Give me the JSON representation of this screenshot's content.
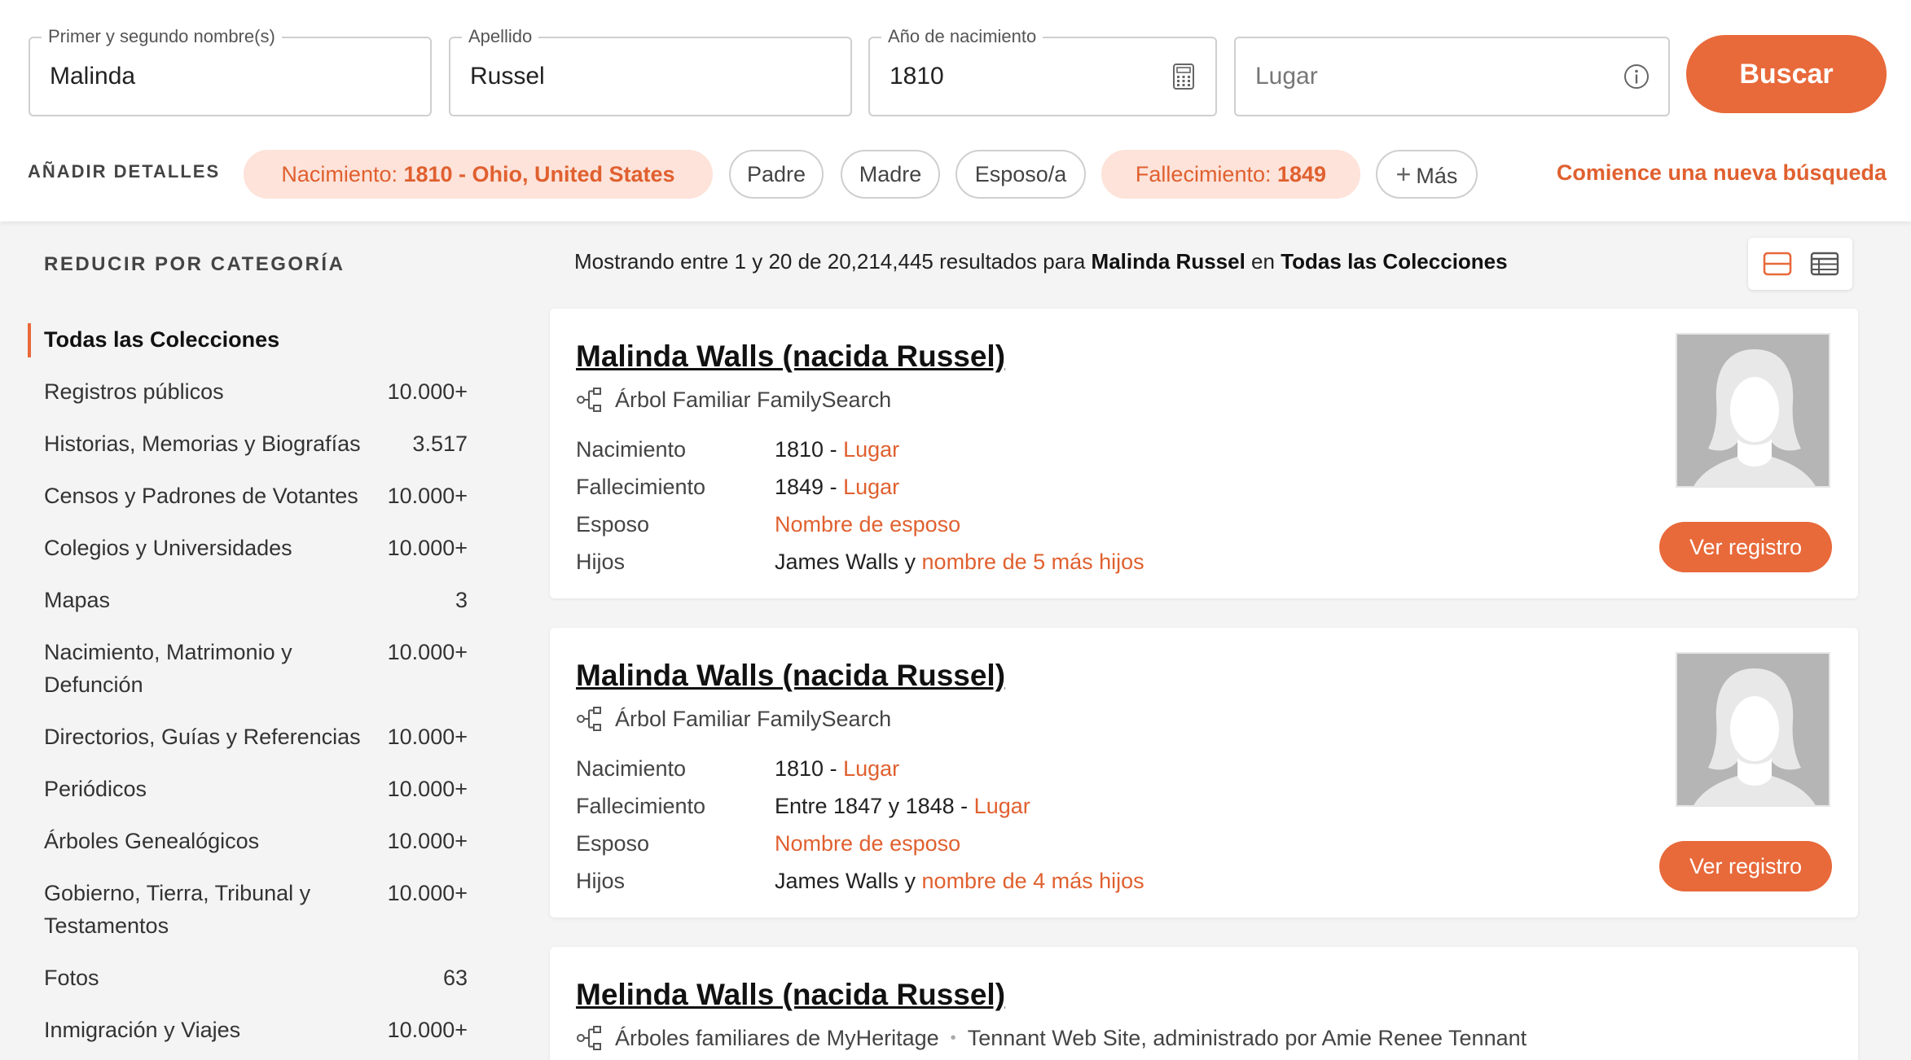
{
  "search": {
    "first_name": {
      "legend": "Primer y segundo nombre(s)",
      "value": "Malinda"
    },
    "last_name": {
      "legend": "Apellido",
      "value": "Russel"
    },
    "birth_year": {
      "legend": "Año de nacimiento",
      "value": "1810"
    },
    "place": {
      "placeholder": "Lugar"
    },
    "search_button": "Buscar"
  },
  "details": {
    "label": "AÑADIR DETALLES",
    "chips": [
      {
        "prefix": "Nacimiento: ",
        "value": "1810 - Ohio, United States"
      },
      {
        "label": "Padre"
      },
      {
        "label": "Madre"
      },
      {
        "label": "Esposo/a"
      },
      {
        "prefix": "Fallecimiento: ",
        "value": "1849"
      },
      {
        "label": "Más"
      }
    ],
    "new_search": "Comience una nueva búsqueda"
  },
  "sidebar": {
    "title": "REDUCIR POR CATEGORÍA",
    "categories": [
      {
        "name": "Todas las Colecciones",
        "count": ""
      },
      {
        "name": "Registros públicos",
        "count": "10.000+"
      },
      {
        "name": "Historias, Memorias y Biografías",
        "count": "3.517"
      },
      {
        "name": "Censos y Padrones de Votantes",
        "count": "10.000+"
      },
      {
        "name": "Colegios y Universidades",
        "count": "10.000+"
      },
      {
        "name": "Mapas",
        "count": "3"
      },
      {
        "name": "Nacimiento, Matrimonio y Defunción",
        "count": "10.000+"
      },
      {
        "name": "Directorios, Guías y Referencias",
        "count": "10.000+"
      },
      {
        "name": "Periódicos",
        "count": "10.000+"
      },
      {
        "name": "Árboles Genealógicos",
        "count": "10.000+"
      },
      {
        "name": "Gobierno, Tierra, Tribunal y Testamentos",
        "count": "10.000+"
      },
      {
        "name": "Fotos",
        "count": "63"
      },
      {
        "name": "Inmigración y Viajes",
        "count": "10.000+"
      }
    ]
  },
  "results": {
    "summary": {
      "pre": "Mostrando entre 1 y 20 de 20,214,445 resultados para ",
      "query": "Malinda Russel",
      "mid": " en ",
      "collection": "Todas las Colecciones"
    },
    "view_button": "Ver registro",
    "items": [
      {
        "name": "Malinda Walls (nacida Russel)",
        "source": "Árbol Familiar FamilySearch",
        "source_extra": "",
        "birth_label": "Nacimiento",
        "birth_value": "1810 - ",
        "birth_link": "Lugar",
        "death_label": "Fallecimiento",
        "death_value": "1849 - ",
        "death_link": "Lugar",
        "spouse_label": "Esposo",
        "spouse_link": "Nombre de esposo",
        "children_label": "Hijos",
        "children_value": "James Walls y ",
        "children_link": "nombre de 5 más hijos"
      },
      {
        "name": "Malinda Walls (nacida Russel)",
        "source": "Árbol Familiar FamilySearch",
        "source_extra": "",
        "birth_label": "Nacimiento",
        "birth_value": "1810 - ",
        "birth_link": "Lugar",
        "death_label": "Fallecimiento",
        "death_value": "Entre 1847 y 1848 - ",
        "death_link": "Lugar",
        "spouse_label": "Esposo",
        "spouse_link": "Nombre de esposo",
        "children_label": "Hijos",
        "children_value": "James Walls y ",
        "children_link": "nombre de 4 más hijos"
      },
      {
        "name": "Melinda Walls (nacida Russel)",
        "source": "Árboles familiares de MyHeritage",
        "source_extra": "Tennant Web Site, administrado por Amie Renee Tennant"
      }
    ]
  },
  "colors": {
    "accent": "#e8693a",
    "chip_bg": "#fde3da",
    "page_bg": "#f4f4f4"
  }
}
